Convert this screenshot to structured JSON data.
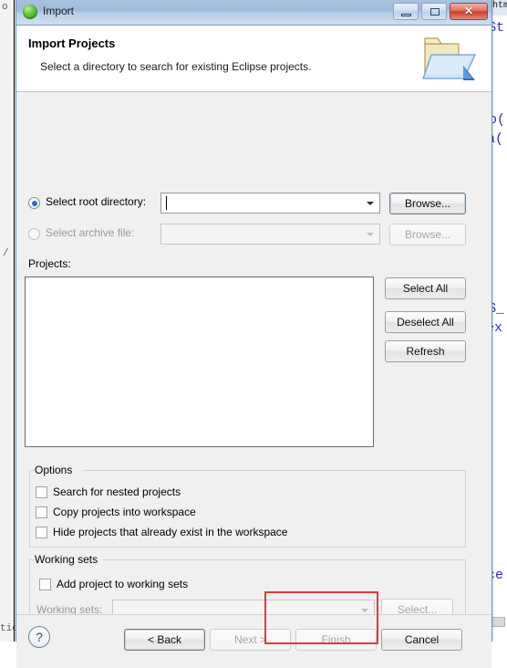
{
  "background": {
    "editor_tab_label": "x.htm",
    "code_fragments": [
      "($t",
      "Fo(",
      "ea(",
      ");",
      "($_",
      ">ex",
      "nce"
    ],
    "left_fragments": [
      "o",
      "/",
      "tio"
    ]
  },
  "window": {
    "title": "Import",
    "icon": "green-sphere-icon",
    "controls": {
      "minimize": "minimize-icon",
      "maximize": "maximize-icon",
      "close": "✕"
    }
  },
  "header": {
    "title": "Import Projects",
    "description": "Select a directory to search for existing Eclipse projects.",
    "icon": "open-folder-import-icon"
  },
  "source": {
    "root_directory": {
      "label": "Select root directory:",
      "selected": true,
      "value": "",
      "placeholder": "",
      "browse_label": "Browse..."
    },
    "archive_file": {
      "label": "Select archive file:",
      "selected": false,
      "enabled": false,
      "value": "",
      "placeholder": "",
      "browse_label": "Browse..."
    }
  },
  "projects": {
    "label": "Projects:",
    "items": [],
    "buttons": {
      "select_all": "Select All",
      "deselect_all": "Deselect All",
      "refresh": "Refresh"
    }
  },
  "options": {
    "title": "Options",
    "checkboxes": [
      {
        "label": "Search for nested projects",
        "checked": false
      },
      {
        "label": "Copy projects into workspace",
        "checked": false
      },
      {
        "label": "Hide projects that already exist in the workspace",
        "checked": false
      }
    ]
  },
  "working_sets": {
    "title": "Working sets",
    "add_checkbox": {
      "label": "Add project to working sets",
      "checked": false
    },
    "combo_label": "Working sets:",
    "combo_value": "",
    "combo_enabled": false,
    "select_label": "Select..."
  },
  "footer": {
    "help": "?",
    "back": "< Back",
    "next": "Next >",
    "finish": "Finish",
    "cancel": "Cancel",
    "back_enabled": true,
    "next_enabled": false,
    "finish_enabled": false,
    "cancel_enabled": true
  },
  "annotation": {
    "color": "#e5383b",
    "target": "finish-button"
  }
}
